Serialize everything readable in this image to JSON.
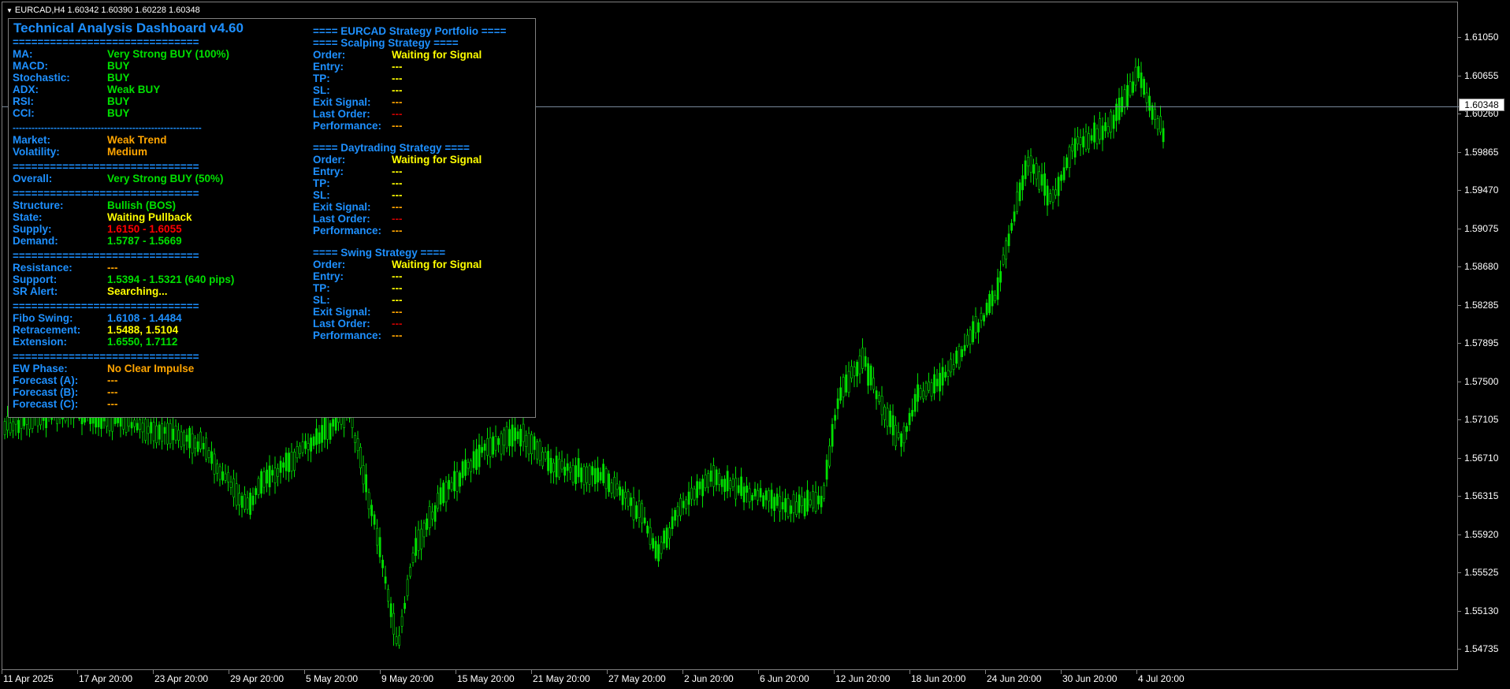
{
  "header": {
    "symbol_line": "EURCAD,H4  1.60342 1.60390 1.60228 1.60348"
  },
  "price_axis": {
    "labels": [
      "1.61050",
      "1.60655",
      "1.60260",
      "1.59865",
      "1.59470",
      "1.59075",
      "1.58680",
      "1.58285",
      "1.57895",
      "1.57500",
      "1.57105",
      "1.56710",
      "1.56315",
      "1.55920",
      "1.55525",
      "1.55130",
      "1.54735"
    ],
    "current_price": "1.60348"
  },
  "time_axis": {
    "labels": [
      "11 Apr 2025",
      "17 Apr 20:00",
      "23 Apr 20:00",
      "29 Apr 20:00",
      "5 May 20:00",
      "9 May 20:00",
      "15 May 20:00",
      "21 May 20:00",
      "27 May 20:00",
      "2 Jun 20:00",
      "6 Jun 20:00",
      "12 Jun 20:00",
      "18 Jun 20:00",
      "24 Jun 20:00",
      "30 Jun 20:00",
      "4 Jul 20:00"
    ]
  },
  "dashboard": {
    "title": "Technical Analysis Dashboard v4.60",
    "sep_long": "==============================",
    "sep_dash": "------------------------------------------------------------",
    "indicators": [
      {
        "label": "MA:",
        "value": "Very Strong BUY (100%)"
      },
      {
        "label": "MACD:",
        "value": "BUY"
      },
      {
        "label": "Stochastic:",
        "value": "BUY"
      },
      {
        "label": "ADX:",
        "value": "Weak BUY"
      },
      {
        "label": "RSI:",
        "value": "BUY"
      },
      {
        "label": "CCI:",
        "value": "BUY"
      }
    ],
    "market": {
      "label": "Market:",
      "value": "Weak Trend"
    },
    "volatility": {
      "label": "Volatility:",
      "value": "Medium"
    },
    "overall": {
      "label": "Overall:",
      "value": "Very Strong BUY (50%)"
    },
    "structure": {
      "label": "Structure:",
      "value": "Bullish (BOS)"
    },
    "state": {
      "label": "State:",
      "value": "Waiting Pullback"
    },
    "supply": {
      "label": "Supply:",
      "value": "1.6150 - 1.6055"
    },
    "demand": {
      "label": "Demand:",
      "value": "1.5787 - 1.5669"
    },
    "resistance": {
      "label": "Resistance:",
      "value": "---"
    },
    "support": {
      "label": "Support:",
      "value": "1.5394 - 1.5321 (640 pips)"
    },
    "sr_alert": {
      "label": "SR Alert:",
      "value": "Searching..."
    },
    "fibo_swing": {
      "label": "Fibo Swing:",
      "value": "1.6108 - 1.4484"
    },
    "retracement": {
      "label": "Retracement:",
      "value": "1.5488, 1.5104"
    },
    "extension": {
      "label": "Extension:",
      "value": "1.6550, 1.7112"
    },
    "ew_phase": {
      "label": "EW Phase:",
      "value": "No Clear Impulse"
    },
    "forecasts": [
      {
        "label": "Forecast (A):",
        "value": "---"
      },
      {
        "label": "Forecast (B):",
        "value": "---"
      },
      {
        "label": "Forecast (C):",
        "value": "---"
      }
    ],
    "portfolio": {
      "title": "==== EURCAD Strategy Portfolio ====",
      "strategies": [
        {
          "title": "==== Scalping Strategy ====",
          "order": "Waiting for Signal",
          "entry": "---",
          "tp": "---",
          "sl": "---",
          "exit_signal": "---",
          "last_order": "---",
          "performance": "---"
        },
        {
          "title": "==== Daytrading Strategy ====",
          "order": "Waiting for Signal",
          "entry": "---",
          "tp": "---",
          "sl": "---",
          "exit_signal": "---",
          "last_order": "---",
          "performance": "---"
        },
        {
          "title": "==== Swing Strategy ====",
          "order": "Waiting for Signal",
          "entry": "---",
          "tp": "---",
          "sl": "---",
          "exit_signal": "---",
          "last_order": "---",
          "performance": "---"
        }
      ],
      "row_labels": {
        "order": "Order:",
        "entry": "Entry:",
        "tp": "TP:",
        "sl": "SL:",
        "exit_signal": "Exit Signal:",
        "last_order": "Last Order:",
        "performance": "Performance:"
      }
    }
  },
  "colors": {
    "candle": "#00E000",
    "axis_text": "#FFFFFF",
    "panel_blue": "#1E90FF"
  }
}
